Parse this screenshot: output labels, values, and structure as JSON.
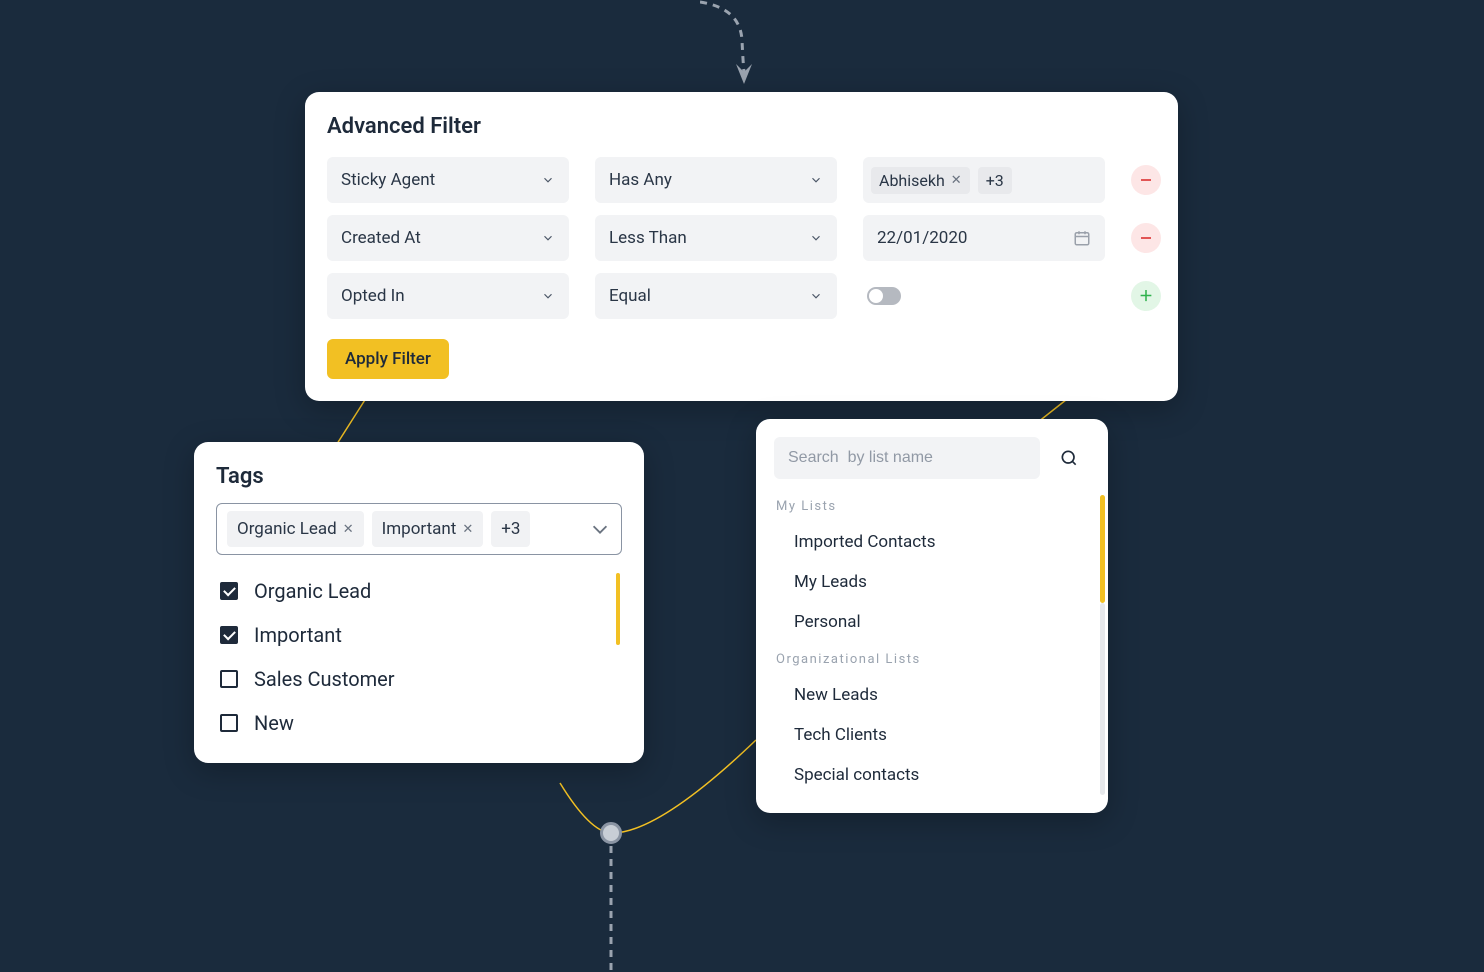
{
  "filter": {
    "title": "Advanced Filter",
    "rows": [
      {
        "field": "Sticky Agent",
        "op": "Has Any",
        "value_tag": "Abhisekh",
        "value_more": "+3"
      },
      {
        "field": "Created At",
        "op": "Less Than",
        "value_date": "22/01/2020"
      },
      {
        "field": "Opted In",
        "op": "Equal"
      }
    ],
    "apply": "Apply Filter"
  },
  "tags": {
    "title": "Tags",
    "selected": [
      "Organic Lead",
      "Important"
    ],
    "more": "+3",
    "items": [
      {
        "label": "Organic Lead",
        "checked": true
      },
      {
        "label": "Important",
        "checked": true
      },
      {
        "label": "Sales Customer",
        "checked": false
      },
      {
        "label": "New",
        "checked": false
      }
    ]
  },
  "lists": {
    "search_placeholder": "Search  by list name",
    "section1": "My Lists",
    "section1_items": [
      "Imported Contacts",
      "My Leads",
      "Personal"
    ],
    "section2": "Organizational Lists",
    "section2_items": [
      "New Leads",
      "Tech Clients",
      "Special contacts"
    ]
  }
}
